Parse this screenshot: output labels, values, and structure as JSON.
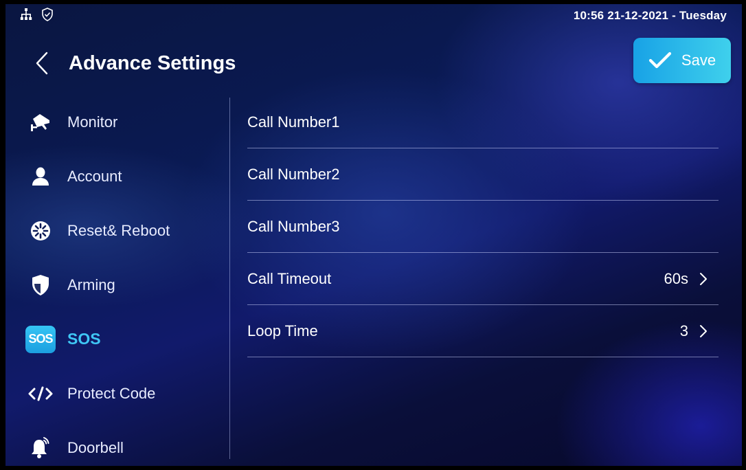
{
  "status": {
    "time": "10:56  21-12-2021 - Tuesday",
    "icons": [
      "network-icon",
      "shield-check-icon"
    ]
  },
  "header": {
    "title": "Advance Settings",
    "save_label": "Save"
  },
  "sidebar": {
    "items": [
      {
        "label": "Monitor",
        "icon": "camera-icon"
      },
      {
        "label": "Account",
        "icon": "user-icon"
      },
      {
        "label": "Reset& Reboot",
        "icon": "reset-icon"
      },
      {
        "label": "Arming",
        "icon": "shield-icon"
      },
      {
        "label": "SOS",
        "icon": "sos-icon",
        "badge": "SOS",
        "active": true
      },
      {
        "label": "Protect Code",
        "icon": "code-icon"
      },
      {
        "label": "Doorbell",
        "icon": "bell-icon"
      }
    ]
  },
  "main": {
    "rows": [
      {
        "label": "Call Number1",
        "value": ""
      },
      {
        "label": "Call Number2",
        "value": ""
      },
      {
        "label": "Call Number3",
        "value": ""
      },
      {
        "label": "Call Timeout",
        "value": "60s"
      },
      {
        "label": "Loop Time",
        "value": "3"
      }
    ]
  },
  "colors": {
    "accent": "#3fc7f5",
    "save_gradient_start": "#18a2e6",
    "save_gradient_end": "#3fd0ec"
  }
}
